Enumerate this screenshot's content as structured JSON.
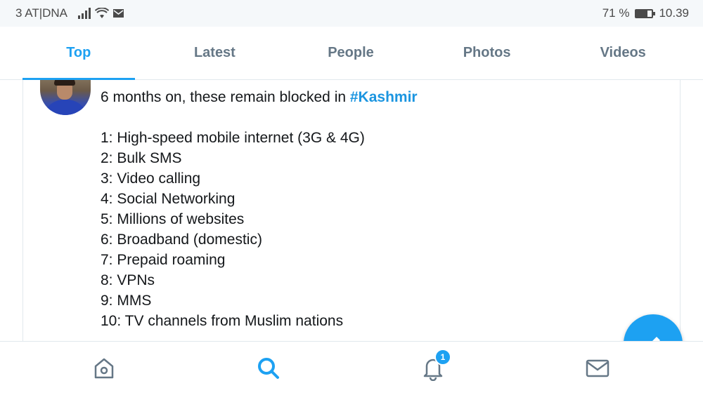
{
  "status_bar": {
    "carrier": "3 AT|DNA",
    "battery_percent": "71 %",
    "battery_level": 0.71,
    "time": "10.39"
  },
  "tabs": [
    {
      "label": "Top",
      "active": true
    },
    {
      "label": "Latest",
      "active": false
    },
    {
      "label": "People",
      "active": false
    },
    {
      "label": "Photos",
      "active": false
    },
    {
      "label": "Videos",
      "active": false
    }
  ],
  "tweet": {
    "text_prefix": "6 months on, these remain blocked in ",
    "hashtag": "#Kashmir",
    "list": [
      "1: High-speed mobile internet (3G & 4G)",
      "2: Bulk SMS",
      "3: Video calling",
      "4: Social Networking",
      "5: Millions of websites",
      "6: Broadband (domestic)",
      "7: Prepaid roaming",
      "8: VPNs",
      "9: MMS",
      "10: TV channels from Muslim nations"
    ]
  },
  "bottom_nav": {
    "items": [
      {
        "icon": "home-icon"
      },
      {
        "icon": "search-icon",
        "active": true
      },
      {
        "icon": "notifications-icon",
        "badge": "1"
      },
      {
        "icon": "messages-icon"
      }
    ]
  },
  "colors": {
    "accent": "#1da1f2",
    "hashtag": "#1b95e0",
    "inactive": "#657786"
  }
}
